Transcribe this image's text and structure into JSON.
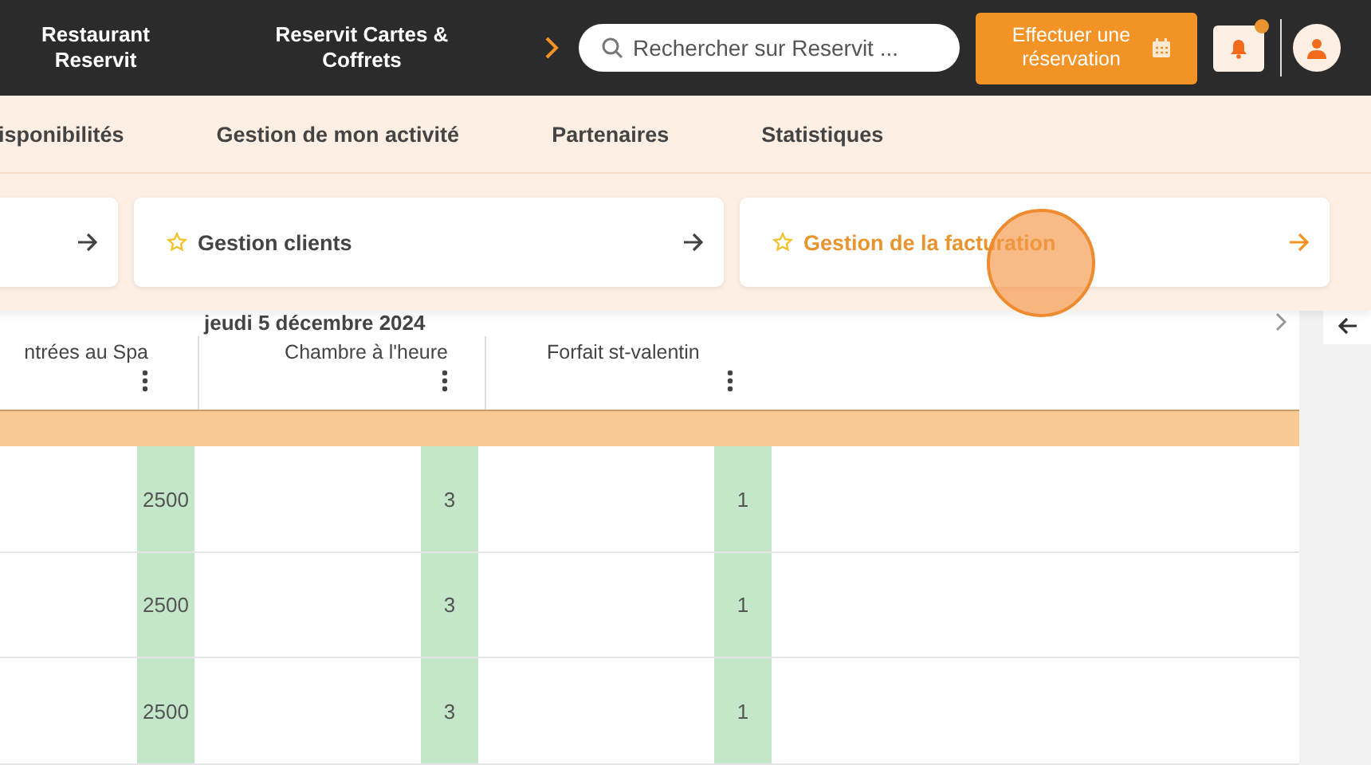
{
  "header": {
    "brands": [
      "Restaurant Reservit",
      "Reservit Cartes & Coffrets"
    ],
    "search": {
      "placeholder": "Rechercher sur Reservit ..."
    },
    "reserve_button": "Effectuer une réservation",
    "notifications": {
      "unread": true
    }
  },
  "nav": [
    {
      "label": "isponibilités"
    },
    {
      "label": "Gestion de mon activité"
    },
    {
      "label": "Partenaires"
    },
    {
      "label": "Statistiques"
    }
  ],
  "shortcuts": [
    {
      "highlighted": false,
      "starred": false
    },
    {
      "label": "Gestion clients",
      "highlighted": false,
      "starred": true
    },
    {
      "label": "Gestion de la facturation",
      "highlighted": true,
      "starred": true
    }
  ],
  "planning": {
    "date": "jeudi 5 décembre 2024",
    "columns": [
      "ntrées au Spa",
      "Chambre à l'heure",
      "Forfait st-valentin"
    ],
    "rows": [
      [
        "2500",
        "3",
        "1"
      ],
      [
        "2500",
        "3",
        "1"
      ],
      [
        "2500",
        "3",
        "1"
      ]
    ]
  }
}
